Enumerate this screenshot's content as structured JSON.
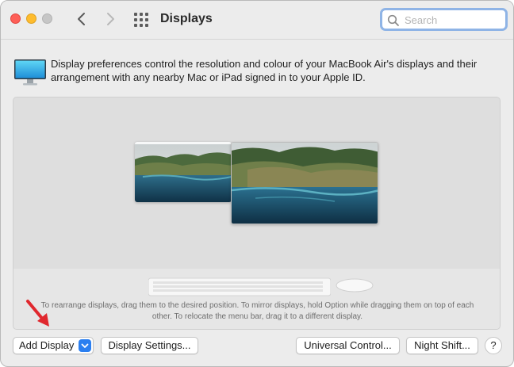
{
  "window": {
    "title": "Displays",
    "controls": [
      "close",
      "minimize",
      "zoom"
    ]
  },
  "toolbar": {
    "back_icon": "chevron-left-icon",
    "forward_icon": "chevron-right-icon",
    "grid_icon": "show-all-grid-icon"
  },
  "search": {
    "placeholder": "Search",
    "value": ""
  },
  "description": {
    "icon": "monitor-icon",
    "text": "Display preferences control the resolution and colour of your MacBook Air's displays and their arrangement with any nearby Mac or iPad signed in to your Apple ID."
  },
  "arrangement": {
    "displays": [
      "secondary-display",
      "main-display"
    ],
    "hint": "To rearrange displays, drag them to the desired position. To mirror displays, hold Option while dragging them on top of each other. To relocate the menu bar, drag it to a different display."
  },
  "buttons": {
    "add_display": "Add Display",
    "display_settings": "Display Settings...",
    "universal_control": "Universal Control...",
    "night_shift": "Night Shift...",
    "help": "?"
  },
  "colors": {
    "accent": "#2b7ff0",
    "close": "#fe5f57",
    "minimize": "#febc2e",
    "annotation_arrow": "#e0282e"
  }
}
